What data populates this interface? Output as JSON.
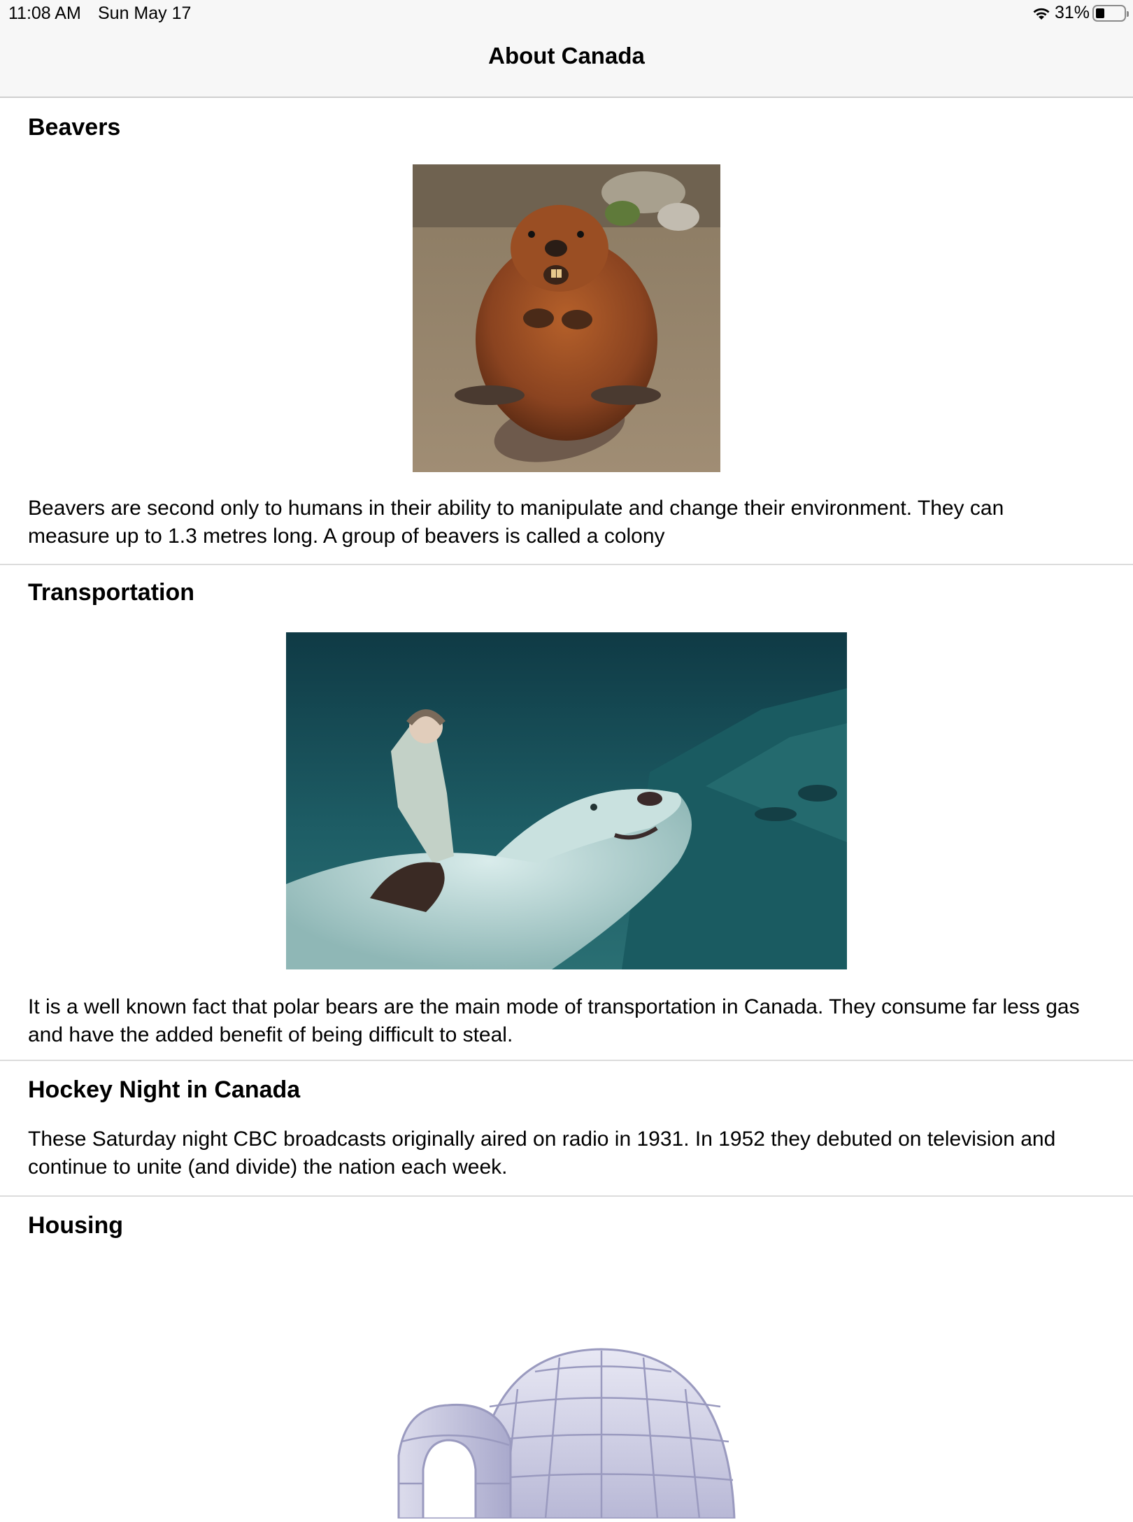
{
  "status_bar": {
    "time": "11:08 AM",
    "date": "Sun May 17",
    "battery_percent": "31%"
  },
  "nav": {
    "title": "About Canada"
  },
  "sections": [
    {
      "title": "Beavers",
      "image": "beaver-photo",
      "body": "Beavers are second only to humans in their ability to manipulate and change their environment. They can measure up to 1.3 metres long. A group of beavers is called a colony"
    },
    {
      "title": "Transportation",
      "image": "girl-riding-polar-bear-photo",
      "body": "It is a well known fact that polar bears are the main mode of transportation in Canada. They consume far less gas and have the added benefit of being difficult to steal."
    },
    {
      "title": "Hockey Night in Canada",
      "body": "These Saturday night CBC broadcasts originally aired on radio in 1931. In 1952 they debuted on television and continue to unite (and divide) the nation each week."
    },
    {
      "title": "Housing",
      "image": "igloo-illustration"
    }
  ]
}
